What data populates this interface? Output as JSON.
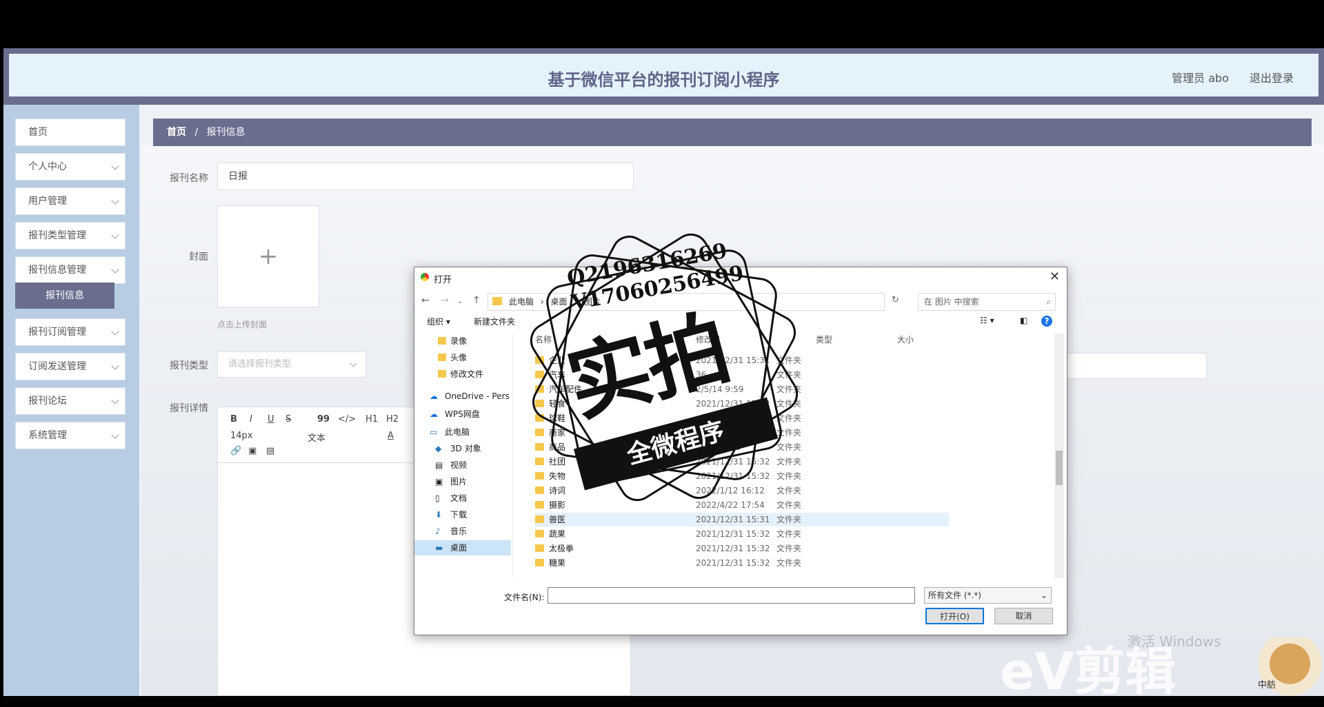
{
  "header": {
    "title": "基于微信平台的报刊订阅小程序",
    "user": "管理员 abo",
    "logout": "退出登录"
  },
  "sidebar": {
    "items": [
      {
        "label": "首页"
      },
      {
        "label": "个人中心"
      },
      {
        "label": "用户管理"
      },
      {
        "label": "报刊类型管理"
      },
      {
        "label": "报刊信息管理"
      },
      {
        "label": "报刊订阅管理"
      },
      {
        "label": "订阅发送管理"
      },
      {
        "label": "报刊论坛"
      },
      {
        "label": "系统管理"
      }
    ],
    "active_sub": "报刊信息"
  },
  "breadcrumb": {
    "home": "首页",
    "sep": "/",
    "current": "报刊信息"
  },
  "form": {
    "name_label": "报刊名称",
    "name_value": "日报",
    "cover_label": "封面",
    "cover_plus": "+",
    "cover_hint": "点击上传封面",
    "type_label": "报刊类型",
    "type_placeholder": "请选择报刊类型",
    "detail_label": "报刊详情"
  },
  "editor": {
    "bold": "B",
    "italic": "I",
    "underline": "U",
    "strike": "S",
    "quote": "99",
    "code": "</>",
    "h1": "H1",
    "h2": "H2",
    "font_size": "14px",
    "para": "文本",
    "color": "A"
  },
  "dialog": {
    "title": "打开",
    "close": "✕",
    "path": [
      "此电脑",
      "桌面",
      "图片"
    ],
    "search_placeholder": "在 图片 中搜索",
    "organize": "组织 ▾",
    "new_folder": "新建文件夹",
    "help": "?",
    "tree": [
      {
        "label": "录像"
      },
      {
        "label": "头像"
      },
      {
        "label": "修改文件"
      },
      {
        "label": "OneDrive - Pers"
      },
      {
        "label": "WPS网盘"
      },
      {
        "label": "此电脑"
      },
      {
        "label": "3D 对象"
      },
      {
        "label": "视频"
      },
      {
        "label": "图片"
      },
      {
        "label": "文档"
      },
      {
        "label": "下载"
      },
      {
        "label": "音乐"
      },
      {
        "label": "桌面"
      }
    ],
    "columns": {
      "name": "名称",
      "date": "修改日",
      "type": "类型",
      "size": "大小"
    },
    "rows": [
      {
        "name": "企业",
        "date": "2021/12/31 15:31",
        "type": "文件夹"
      },
      {
        "name": "汽车",
        "date": "36",
        "type": "文件夹"
      },
      {
        "name": "汽车配件",
        "date": "2/5/14 9:59",
        "type": "文件夹"
      },
      {
        "name": "轻食",
        "date": "2021/12/31 15:32",
        "type": "文件夹"
      },
      {
        "name": "球鞋",
        "date": "",
        "type": "文件夹"
      },
      {
        "name": "商家",
        "date": "",
        "type": "文件夹"
      },
      {
        "name": "商品",
        "date": "4/16 11:35",
        "type": "文件夹"
      },
      {
        "name": "社团",
        "date": "2021/12/31 15:32",
        "type": "文件夹"
      },
      {
        "name": "失物",
        "date": "2021/12/31 15:32",
        "type": "文件夹"
      },
      {
        "name": "诗词",
        "date": "2022/1/12 16:12",
        "type": "文件夹"
      },
      {
        "name": "摄影",
        "date": "2022/4/22 17:54",
        "type": "文件夹"
      },
      {
        "name": "兽医",
        "date": "2021/12/31 15:31",
        "type": "文件夹"
      },
      {
        "name": "蔬果",
        "date": "2021/12/31 15:32",
        "type": "文件夹"
      },
      {
        "name": "太极拳",
        "date": "2021/12/31 15:32",
        "type": "文件夹"
      },
      {
        "name": "糖果",
        "date": "2021/12/31 15:32",
        "type": "文件夹"
      }
    ],
    "filename_label": "文件名(N):",
    "filetype": "所有文件 (*.*)",
    "open_btn": "打开(O)",
    "cancel_btn": "取消"
  },
  "stamp": {
    "qq": "Q2196316269",
    "v": "V17060256499",
    "big": "实拍",
    "band": "全微程序"
  },
  "overlay": {
    "activate": "激活 Windows",
    "ev": "eV剪辑",
    "badge": "中舫"
  }
}
